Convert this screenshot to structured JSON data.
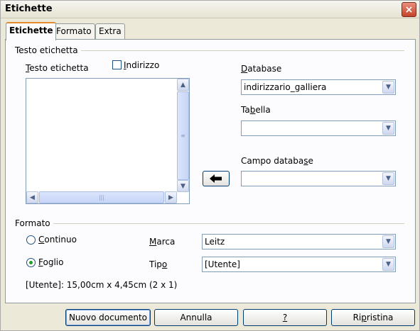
{
  "window": {
    "title": "Etichette",
    "close_icon": "×"
  },
  "tabs": [
    {
      "label": "Etichette",
      "active": true
    },
    {
      "label": "Formato",
      "active": false
    },
    {
      "label": "Extra",
      "active": false
    }
  ],
  "label_text_group": {
    "title": "Testo etichetta",
    "field_label": "Testo etichetta",
    "field_label_mnemonic": "T",
    "field_label_rest": "esto etichetta",
    "address_checkbox": {
      "label": "Indirizzo",
      "mnemonic": "I",
      "rest": "ndirizzo",
      "checked": false
    },
    "textarea_value": ""
  },
  "database": {
    "label_a": "D",
    "label_b": "atabase",
    "value": "indirizzario_galliera"
  },
  "table": {
    "label_a": "Ta",
    "label_b": "b",
    "label_c": "ella",
    "value": ""
  },
  "db_field": {
    "label_a": "Campo databa",
    "label_b": "s",
    "label_c": "e",
    "value": ""
  },
  "insert_arrow_icon": "left-arrow-icon",
  "format_group": {
    "title": "Formato",
    "continuous": {
      "label_a": "C",
      "label_b": "ontinuo",
      "selected": false
    },
    "sheet": {
      "label_a": "F",
      "label_b": "oglio",
      "selected": true
    },
    "brand": {
      "label_a": "M",
      "label_b": "arca",
      "value": "Leitz"
    },
    "type": {
      "label_a": "Tip",
      "label_b": "o",
      "value": "[Utente]"
    },
    "summary": "[Utente]: 15,00cm x 4,45cm (2 x 1)"
  },
  "buttons": {
    "new_document": "Nuovo documento",
    "cancel": "Annulla",
    "help": "?",
    "reset_a": "Ri",
    "reset_b": "p",
    "reset_c": "ristina"
  },
  "scroll_glyphs": {
    "up": "▲",
    "down": "▼",
    "left": "◀",
    "right": "▶",
    "grip_v": "≡",
    "grip_h": "|||",
    "drop": "▼"
  }
}
